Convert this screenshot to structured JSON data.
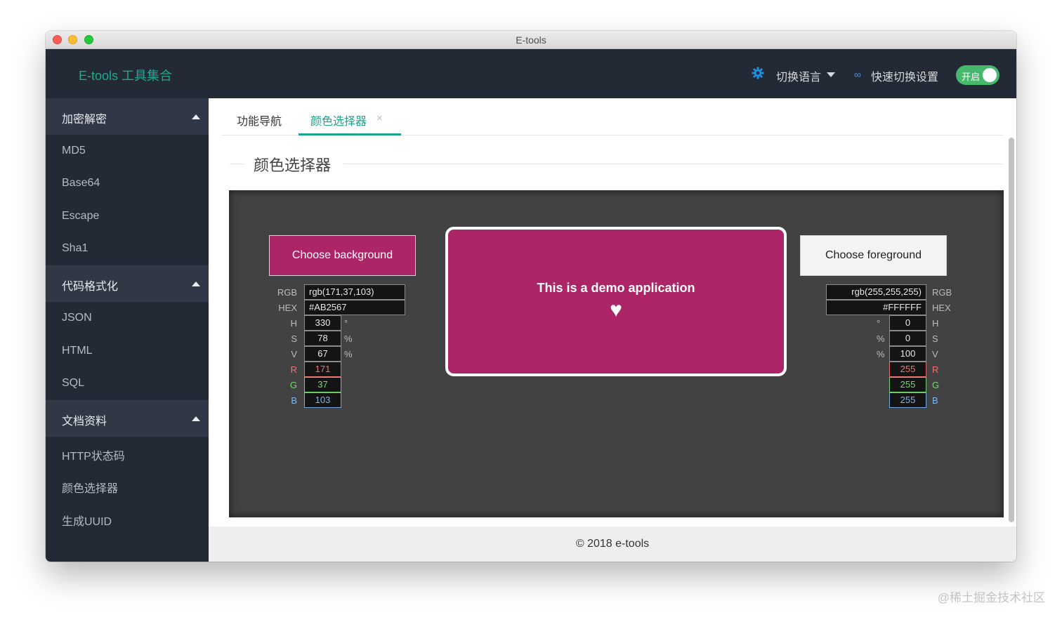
{
  "window": {
    "title": "E-tools"
  },
  "header": {
    "brand": "E-tools 工具集合",
    "language_label": "切换语言",
    "quick_switch_label": "快速切换设置",
    "toggle_label": "开启",
    "accent_color": "#20a98a"
  },
  "sidebar": {
    "groups": [
      {
        "title": "加密解密",
        "items": [
          "MD5",
          "Base64",
          "Escape",
          "Sha1"
        ]
      },
      {
        "title": "代码格式化",
        "items": [
          "JSON",
          "HTML",
          "SQL"
        ]
      },
      {
        "title": "文档资料",
        "items": [
          "HTTP状态码",
          "颜色选择器",
          "生成UUID"
        ]
      }
    ]
  },
  "tabs": [
    {
      "label": "功能导航",
      "active": false
    },
    {
      "label": "颜色选择器",
      "active": true,
      "close": "×"
    }
  ],
  "page_title": "颜色选择器",
  "demo": {
    "choose_background": "Choose background",
    "choose_foreground": "Choose foreground",
    "preview_text": "This is a demo application",
    "preview_icon": "♥",
    "background": {
      "color": "#AB2567",
      "labels": {
        "rgb": "RGB",
        "hex": "HEX",
        "h": "H",
        "s": "S",
        "v": "V",
        "r": "R",
        "g": "G",
        "b": "B"
      },
      "rgb": "rgb(171,37,103)",
      "hex": "#AB2567",
      "h": "330",
      "s": "78",
      "v": "67",
      "r": "171",
      "g": "37",
      "b": "103",
      "units": {
        "h": "°",
        "s": "%",
        "v": "%"
      }
    },
    "foreground": {
      "color": "#FFFFFF",
      "labels": {
        "rgb": "RGB",
        "hex": "HEX",
        "h": "H",
        "s": "S",
        "v": "V",
        "r": "R",
        "g": "G",
        "b": "B"
      },
      "rgb": "rgb(255,255,255)",
      "hex": "#FFFFFF",
      "h": "0",
      "s": "0",
      "v": "100",
      "r": "255",
      "g": "255",
      "b": "255",
      "units": {
        "h": "°",
        "s": "%",
        "v": "%"
      }
    }
  },
  "footer": "© 2018 e-tools",
  "watermark": "@稀土掘金技术社区"
}
